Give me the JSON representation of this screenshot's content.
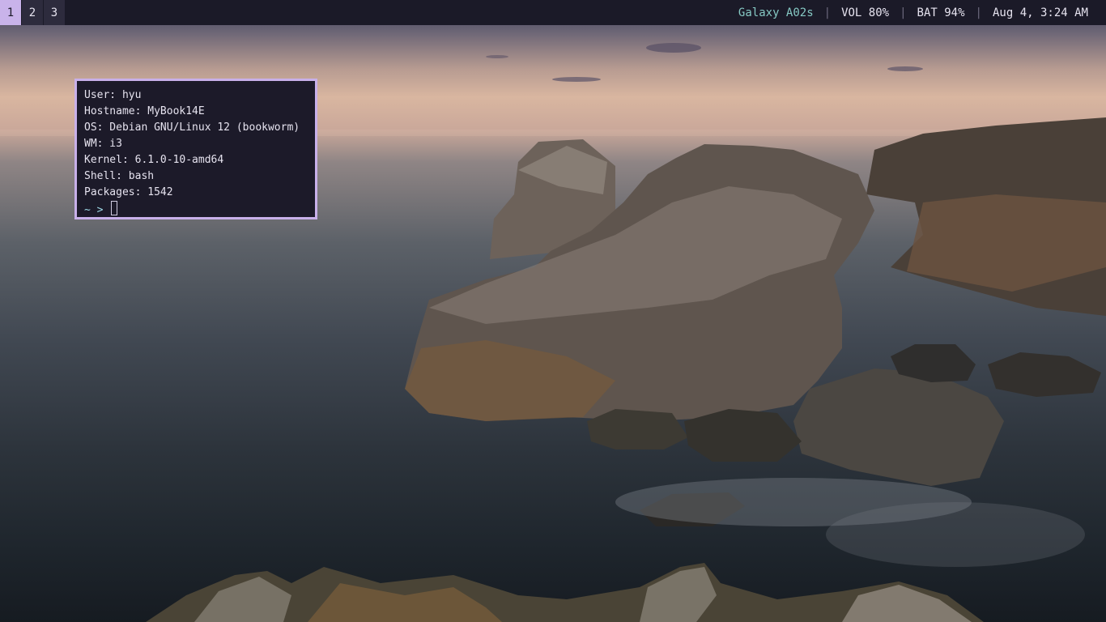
{
  "topbar": {
    "workspaces": [
      {
        "label": "1",
        "active": true
      },
      {
        "label": "2",
        "active": false
      },
      {
        "label": "3",
        "active": false
      }
    ],
    "device": "Galaxy A02s",
    "volume": "VOL 80%",
    "battery": "BAT 94%",
    "datetime": "Aug 4, 3:24 AM",
    "separator": "|"
  },
  "terminal": {
    "lines": [
      "User: hyu",
      "Hostname: MyBook14E",
      "OS: Debian GNU/Linux 12 (bookworm)",
      "WM: i3",
      "Kernel: 6.1.0-10-amd64",
      "Shell: bash",
      "Packages: 1542"
    ],
    "prompt": "~ >"
  },
  "colors": {
    "bar_bg": "#1b1a28",
    "accent": "#c9b3ea",
    "device_text": "#86c9c4",
    "prompt": "#9ed8e6"
  }
}
